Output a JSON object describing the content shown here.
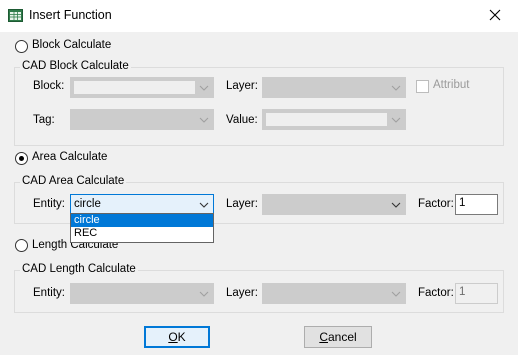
{
  "window": {
    "title": "Insert Function",
    "app_icon": "table-icon",
    "close_icon": "close-icon"
  },
  "block": {
    "radio_label": "Block Calculate",
    "group_title": "CAD Block Calculate",
    "block_label": "Block:",
    "layer_label": "Layer:",
    "attribute_label": "Attribut",
    "tag_label": "Tag:",
    "value_label": "Value:"
  },
  "area": {
    "radio_label": "Area Calculate",
    "group_title": "CAD Area Calculate",
    "entity_label": "Entity:",
    "entity_value": "circle",
    "entity_options": [
      "circle",
      "REC"
    ],
    "layer_label": "Layer:",
    "factor_label": "Factor:",
    "factor_value": "1"
  },
  "length": {
    "radio_label": "Length Calculate",
    "group_title": "CAD Length Calculate",
    "entity_label": "Entity:",
    "layer_label": "Layer:",
    "factor_label": "Factor:",
    "factor_value": "1"
  },
  "buttons": {
    "ok_underlined": "O",
    "ok_rest": "K",
    "cancel_underlined": "C",
    "cancel_rest": "ancel"
  },
  "colors": {
    "accent": "#0078d7",
    "dialog_bg": "#f0f0f0",
    "disabled_combo": "#cccccc"
  }
}
